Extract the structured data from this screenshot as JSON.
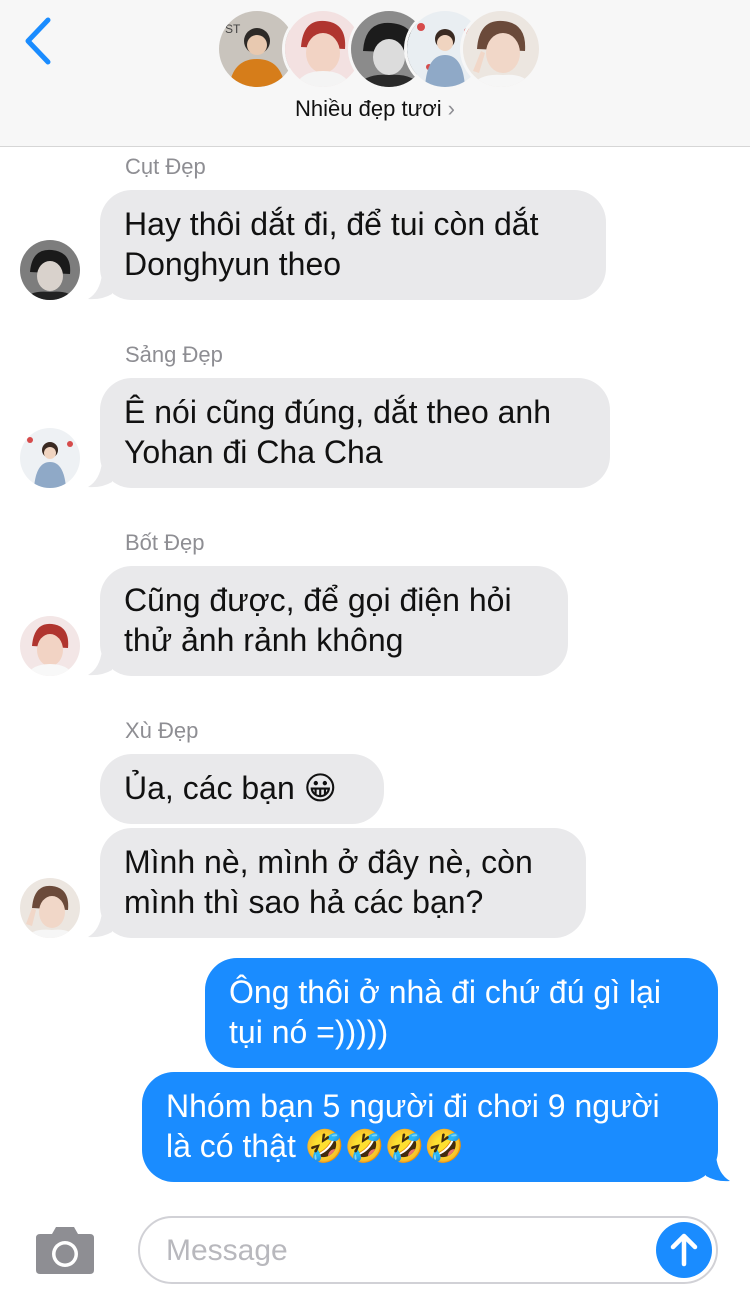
{
  "header": {
    "group_name": "Nhiều đẹp tươi",
    "chevron": "›",
    "avatars": [
      "avatar-1",
      "avatar-2",
      "avatar-3",
      "avatar-4",
      "avatar-5"
    ]
  },
  "messages": [
    {
      "sender": "Cụt Đẹp",
      "text": "Hay thôi dắt đi, để tui còn dắt\nDonghyun theo",
      "direction": "incoming"
    },
    {
      "sender": "Sảng Đẹp",
      "text": "Ê nói cũng đúng, dắt theo anh\nYohan đi Cha Cha",
      "direction": "incoming"
    },
    {
      "sender": "Bốt Đẹp",
      "text": "Cũng được, để gọi điện hỏi\nthử ảnh rảnh không",
      "direction": "incoming"
    },
    {
      "sender": "Xù Đẹp",
      "text": "Ủa, các bạn 😀",
      "direction": "incoming"
    },
    {
      "sender": "",
      "text": "Mình nè, mình ở đây nè, còn\nmình thì sao hả các bạn?",
      "direction": "incoming"
    },
    {
      "sender": "",
      "text": "Ông thôi ở nhà đi chứ đú gì lại\ntụi nó =)))))",
      "direction": "outgoing"
    },
    {
      "sender": "",
      "text": "Nhóm bạn 5 người đi chơi 9 người\nlà có thật 🤣🤣🤣🤣",
      "direction": "outgoing"
    }
  ],
  "input": {
    "placeholder": "Message"
  },
  "colors": {
    "accent": "#1a8cff",
    "incoming_bubble": "#e9e9eb",
    "header_bg": "#f7f7f7"
  },
  "icons": {
    "back": "chevron-left-icon",
    "camera": "camera-icon",
    "send": "arrow-up-icon"
  }
}
